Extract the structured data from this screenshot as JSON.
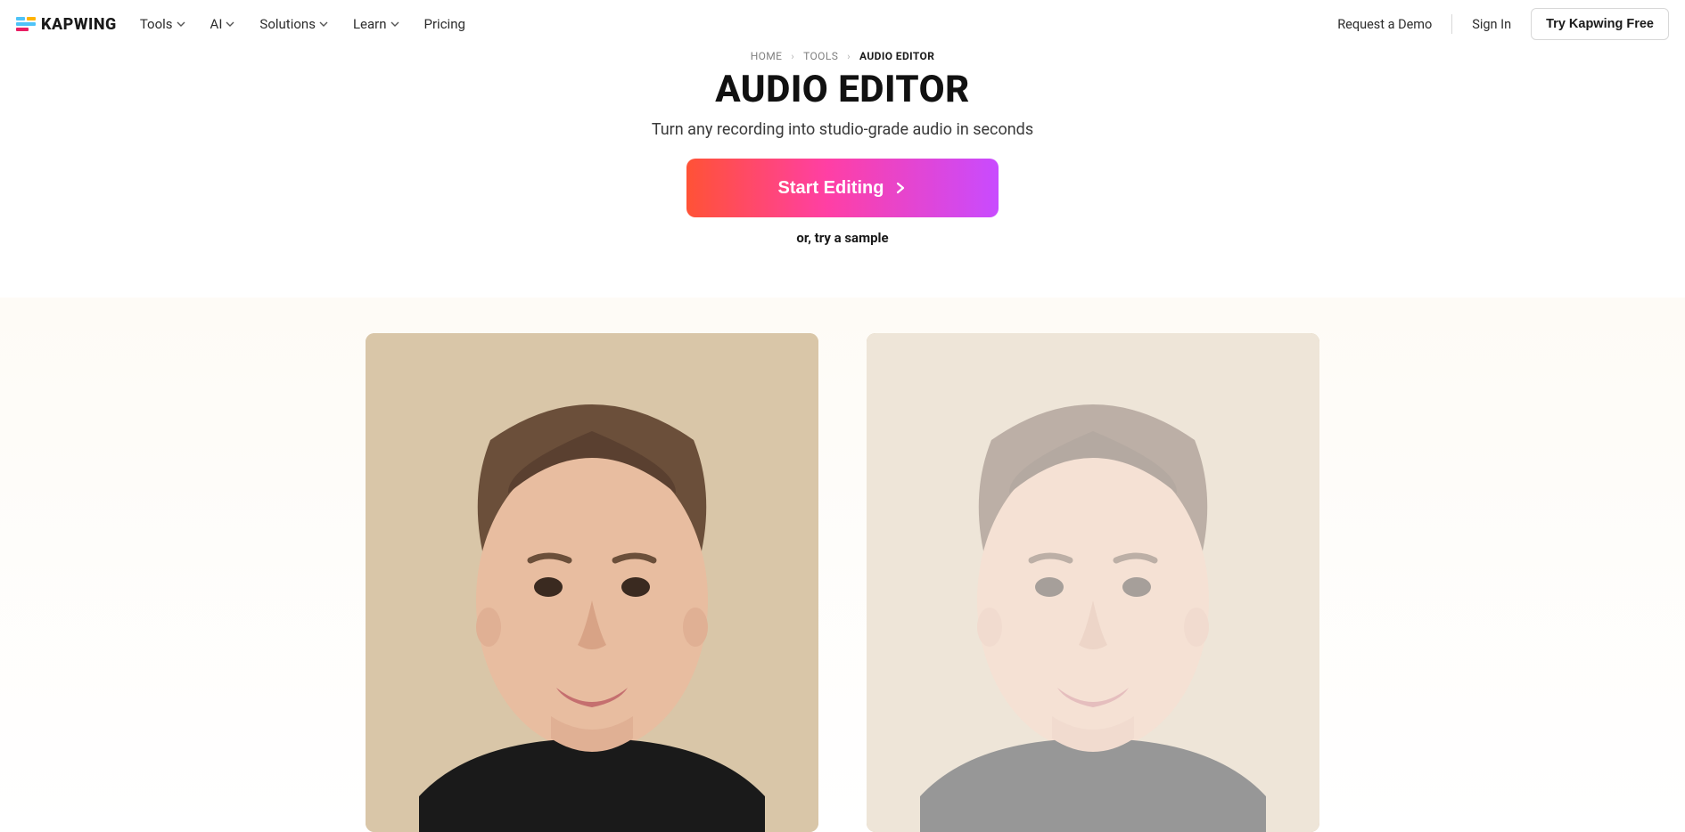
{
  "nav": {
    "brand": "KAPWING",
    "items": [
      "Tools",
      "AI",
      "Solutions",
      "Learn",
      "Pricing"
    ],
    "items_has_dropdown": [
      true,
      true,
      true,
      true,
      false
    ],
    "request_demo": "Request a Demo",
    "sign_in": "Sign In",
    "try_free": "Try Kapwing Free"
  },
  "breadcrumb": {
    "home": "HOME",
    "tools": "TOOLS",
    "current": "AUDIO EDITOR"
  },
  "hero": {
    "title": "AUDIO EDITOR",
    "subtitle": "Turn any recording into studio-grade audio in seconds",
    "cta_label": "Start Editing",
    "sample_label": "or, try a sample"
  }
}
